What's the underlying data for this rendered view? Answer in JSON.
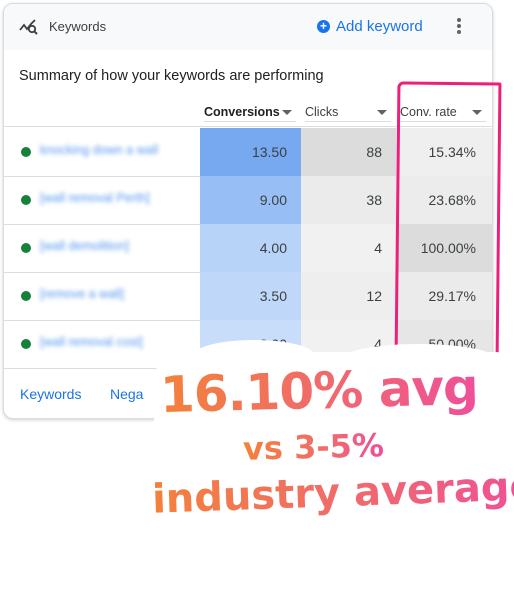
{
  "card": {
    "title": "Keywords",
    "icon": "keyword-planner-icon",
    "add_keyword_label": "Add keyword",
    "more_icon": "more-vertical-icon",
    "summary": "Summary of how your keywords are performing",
    "columns": [
      {
        "label": "Conversions",
        "sorted": true
      },
      {
        "label": "Clicks",
        "sorted": false
      },
      {
        "label": "Conv. rate",
        "sorted": false
      }
    ],
    "rows": [
      {
        "keyword": "knocking down a wall",
        "status": "enabled",
        "conversions": "13.50",
        "clicks": "88",
        "conv_rate": "15.34%"
      },
      {
        "keyword": "[wall removal Perth]",
        "status": "enabled",
        "conversions": "9.00",
        "clicks": "38",
        "conv_rate": "23.68%"
      },
      {
        "keyword": "[wall demolition]",
        "status": "enabled",
        "conversions": "4.00",
        "clicks": "4",
        "conv_rate": "100.00%"
      },
      {
        "keyword": "[remove a wall]",
        "status": "enabled",
        "conversions": "3.50",
        "clicks": "12",
        "conv_rate": "29.17%"
      },
      {
        "keyword": "[wall removal cost]",
        "status": "enabled",
        "conversions": "2.00",
        "clicks": "4",
        "conv_rate": "50.00%"
      }
    ],
    "footer_links": [
      "Keywords",
      "Nega"
    ]
  },
  "colors": {
    "link": "#1a73e8",
    "status_enabled": "#188038",
    "annotation_pink": "#ee1f7c",
    "gradient_start": "#f4813a",
    "gradient_end": "#ef4f9a",
    "conv_heat": [
      "#76a9f0",
      "#98bff5",
      "#b8d3f8",
      "#bfd7f9",
      "#c8ddfa"
    ],
    "clicks_heat": [
      "#dcdcdc",
      "#ebebeb",
      "#f1f1f1",
      "#eeeeee",
      "#f1f1f1"
    ],
    "rate_heat": [
      "#efefef",
      "#ececec",
      "#dcdcdc",
      "#ebebeb",
      "#e6e6e6"
    ]
  },
  "annotation": {
    "line1": "16.10% avg",
    "line2": "vs 3-5%",
    "line3": "industry average"
  }
}
